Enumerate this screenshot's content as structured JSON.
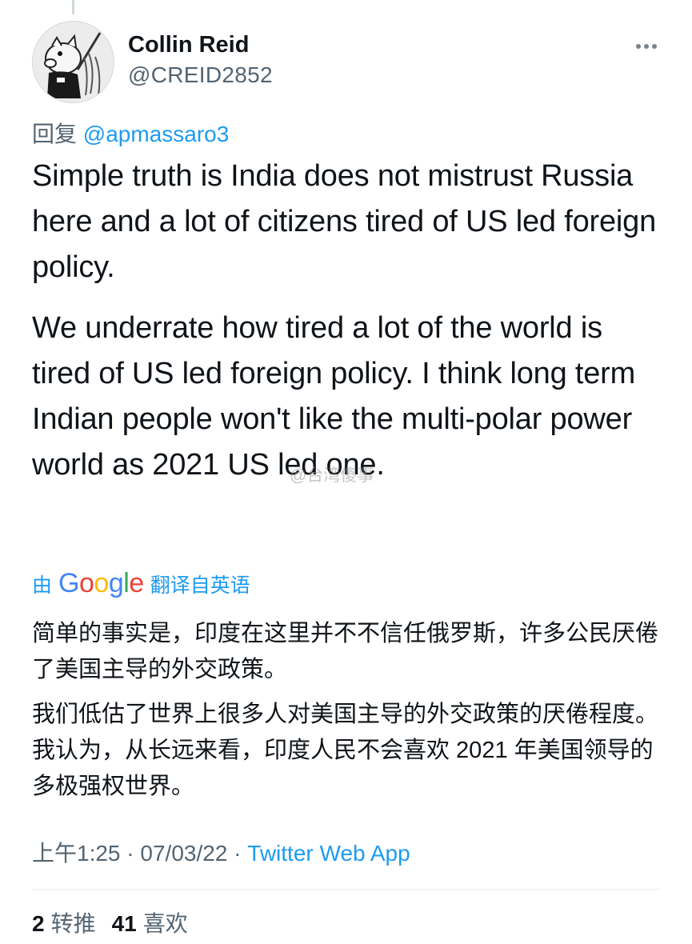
{
  "author": {
    "name": "Collin Reid",
    "handle": "@CREID2852"
  },
  "reply": {
    "prefix": "回复",
    "target": "@apmassaro3"
  },
  "tweet": {
    "paragraphs": [
      "Simple truth is India does not mistrust Russia here and a lot of citizens tired of US led foreign policy.",
      "We underrate how tired a lot of the world is tired of US led foreign policy. I think long term Indian people won't like the multi-polar power world as 2021 US led one."
    ]
  },
  "watermark": "@台湾傻事",
  "translation_bar": {
    "prefix": "由",
    "brand": "Google",
    "suffix": "翻译自英语"
  },
  "translation": {
    "paragraphs": [
      "简单的事实是，印度在这里并不不信任俄罗斯，许多公民厌倦了美国主导的外交政策。",
      "我们低估了世界上很多人对美国主导的外交政策的厌倦程度。我认为，从长远来看，印度人民不会喜欢 2021 年美国领导的多极强权世界。"
    ]
  },
  "meta": {
    "time": "上午1:25",
    "date": "07/03/22",
    "separator": "·",
    "source": "Twitter Web App"
  },
  "stats": {
    "retweets_count": "2",
    "retweets_label": "转推",
    "likes_count": "41",
    "likes_label": "喜欢"
  },
  "icons": {
    "more": "more-options-icon"
  }
}
